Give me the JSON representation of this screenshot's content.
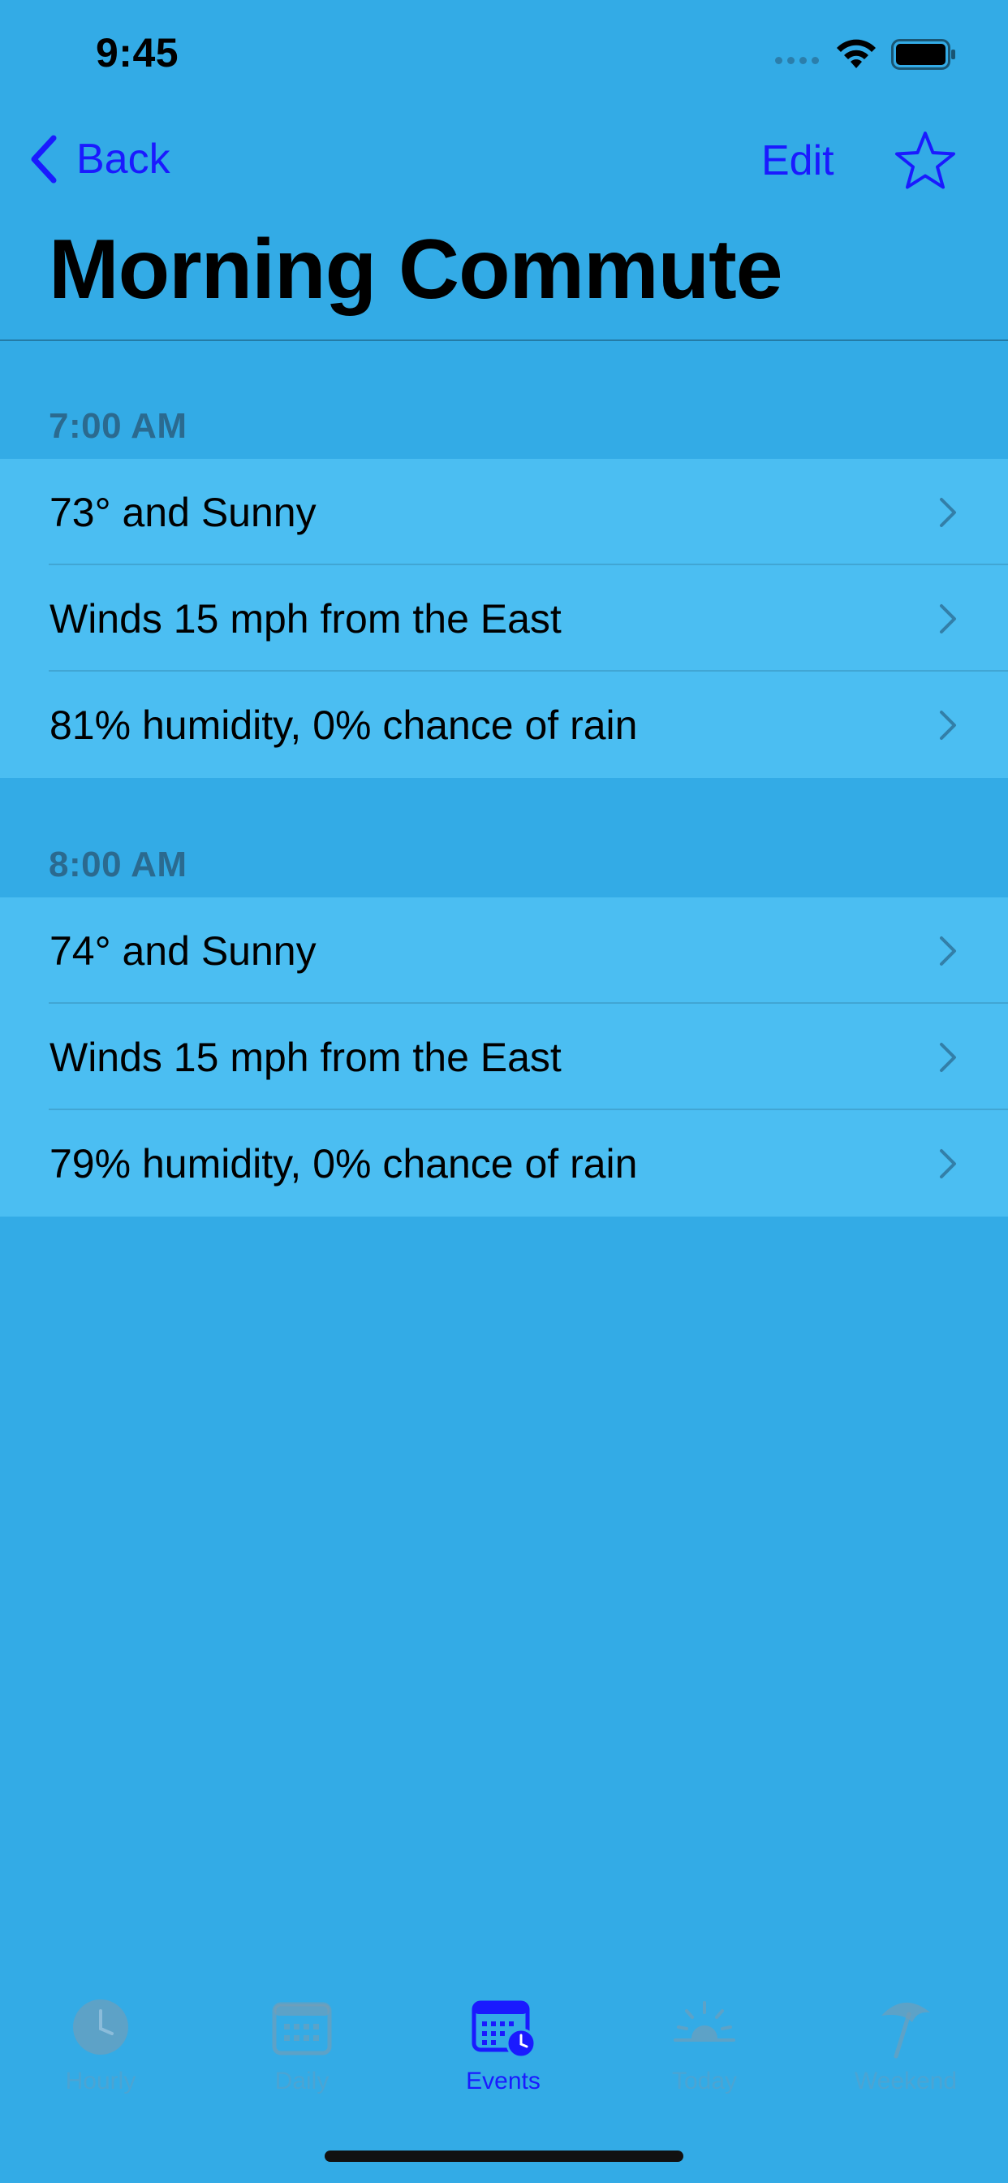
{
  "status_bar": {
    "time": "9:45"
  },
  "nav": {
    "back_label": "Back",
    "edit_label": "Edit",
    "title": "Morning Commute"
  },
  "sections": [
    {
      "header": "7:00 AM",
      "rows": [
        {
          "label": "73° and Sunny"
        },
        {
          "label": "Winds 15 mph from the East"
        },
        {
          "label": "81% humidity, 0% chance of rain"
        }
      ]
    },
    {
      "header": "8:00 AM",
      "rows": [
        {
          "label": "74° and Sunny"
        },
        {
          "label": "Winds 15 mph from the East"
        },
        {
          "label": "79% humidity, 0% chance of rain"
        }
      ]
    }
  ],
  "tab_bar": {
    "tabs": [
      {
        "label": "Hourly",
        "icon": "clock-icon",
        "active": false
      },
      {
        "label": "Daily",
        "icon": "calendar-icon",
        "active": false
      },
      {
        "label": "Events",
        "icon": "calendar-clock-icon",
        "active": true
      },
      {
        "label": "Today",
        "icon": "sunrise-icon",
        "active": false
      },
      {
        "label": "Weekend",
        "icon": "beach-umbrella-icon",
        "active": false
      }
    ]
  },
  "colors": {
    "background": "#33ABE6",
    "row_background": "#4BBEF2",
    "accent": "#1A1AFF",
    "section_header": "#2b6a8f"
  }
}
